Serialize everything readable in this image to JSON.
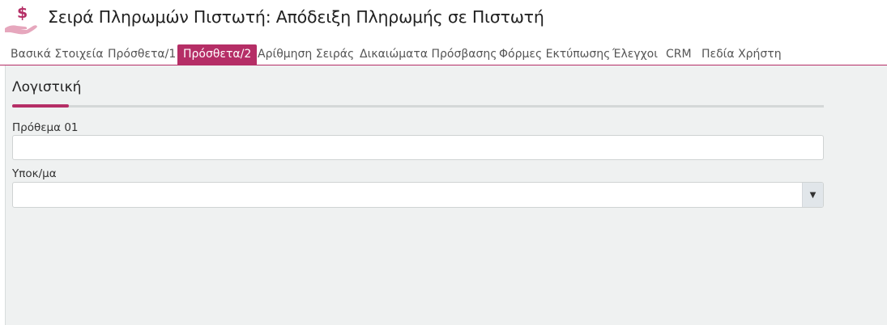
{
  "header": {
    "title": "Σειρά Πληρωμών Πιστωτή: Απόδειξη Πληρωμής σε Πιστωτή",
    "icon": "money-hand-icon",
    "icon_colors": {
      "dollar": "#b52e66",
      "hand": "#e6a7bd"
    }
  },
  "tabs": [
    {
      "label": "Βασικά Στοιχεία",
      "active": false
    },
    {
      "label": "Πρόσθετα/1",
      "active": false
    },
    {
      "label": "Πρόσθετα/2",
      "active": true
    },
    {
      "label": "Αρίθμηση Σειράς",
      "active": false
    },
    {
      "label": "Δικαιώματα Πρόσβασης",
      "active": false
    },
    {
      "label": "Φόρμες Εκτύπωσης",
      "active": false
    },
    {
      "label": "Έλεγχοι",
      "active": false
    },
    {
      "label": "CRM",
      "active": false
    },
    {
      "label": "Πεδία Χρήστη",
      "active": false
    }
  ],
  "section": {
    "title": "Λογιστική",
    "fields": {
      "prefix": {
        "label": "Πρόθεμα 01",
        "value": ""
      },
      "subaccount": {
        "label": "Υποκ/μα",
        "value": ""
      }
    }
  },
  "theme": {
    "accent": "#b52e66",
    "panel_bg": "#eff1f1"
  }
}
